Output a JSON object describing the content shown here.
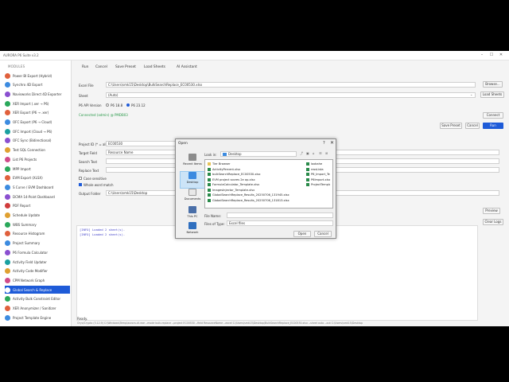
{
  "app": {
    "title": "AURORA P6 Suite v3.2",
    "window_controls": [
      "–",
      "☐",
      "✕"
    ]
  },
  "sidebar": {
    "header": "MODULES",
    "items": [
      {
        "label": "Power BI Export (Hybrid)",
        "color": "#e0603c"
      },
      {
        "label": "Synchro 4D Export",
        "color": "#3c8be0"
      },
      {
        "label": "Navisworks Direct 4D Exporter",
        "color": "#8a4fd0"
      },
      {
        "label": "XER Import (.xer → P6)",
        "color": "#2aa85a"
      },
      {
        "label": "XER Export (P6 → .xer)",
        "color": "#e0603c"
      },
      {
        "label": "OFC Export (P6 → Cloud)",
        "color": "#3c8be0"
      },
      {
        "label": "OFC Import (Cloud → P6)",
        "color": "#1aa0a0"
      },
      {
        "label": "OFC Sync (Bidirectional)",
        "color": "#8a4fd0"
      },
      {
        "label": "Test SQL Connection",
        "color": "#e0a030"
      },
      {
        "label": "List P6 Projects",
        "color": "#d04a8a"
      },
      {
        "label": "MPP Import",
        "color": "#2aa85a"
      },
      {
        "label": "EVM Export (XLSX)",
        "color": "#e0603c"
      },
      {
        "label": "S Curve / EVM Dashboard",
        "color": "#3c8be0"
      },
      {
        "label": "DCMA 14-Point Dashboard",
        "color": "#8a4fd0"
      },
      {
        "label": "PDF Report",
        "color": "#d03c3c"
      },
      {
        "label": "Schedule Update",
        "color": "#e0a030"
      },
      {
        "label": "WBS Summary",
        "color": "#2aa85a"
      },
      {
        "label": "Resource Histogram",
        "color": "#e0603c"
      },
      {
        "label": "Project Summary",
        "color": "#3c8be0"
      },
      {
        "label": "P6 Formula Calculator",
        "color": "#8a4fd0"
      },
      {
        "label": "Activity Field Updater",
        "color": "#1aa0a0"
      },
      {
        "label": "Activity Code Modifier",
        "color": "#e0a030"
      },
      {
        "label": "CPM Network Graph",
        "color": "#d04a8a"
      },
      {
        "label": "Global Search & Replace",
        "color": "#1e5bd8",
        "active": true
      },
      {
        "label": "Activity Bulk Constraint Editor",
        "color": "#2aa85a"
      },
      {
        "label": "XER Anonymizer / Sanitizer",
        "color": "#e0603c"
      },
      {
        "label": "Project Template Engine",
        "color": "#3c8be0"
      }
    ]
  },
  "toolbar": {
    "run": "Run",
    "cancel": "Cancel",
    "save_preset": "Save Preset",
    "load_sheets": "Load Sheets",
    "ai_assistant": "AI Assistant"
  },
  "form": {
    "excel_file_label": "Excel File",
    "excel_file_value": "C:\\Users\\smk15\\Desktop\\BulkSearchReplace_EC00530.xlsx",
    "browse": "Browse...",
    "sheet_label": "Sheet",
    "sheet_value": "(Auto)",
    "load_sheets_btn": "Load Sheets",
    "p6_api_label": "P6 API Version",
    "p6_v1": "P6 18.8",
    "p6_v2": "P6 23.12",
    "connected": "Connected (admin) @ PMDB03",
    "connect_btn": "Connect",
    "save_preset_btn": "Save Preset",
    "cancel_btn": "Cancel",
    "run_btn": "Run",
    "project_id_label": "Project ID (* = all)",
    "project_id_value": "EC00530",
    "target_field_label": "Target Field",
    "target_field_value": "Resource Name",
    "search_text_label": "Search Text",
    "replace_text_label": "Replace Text",
    "case_sensitive": "Case sensitive",
    "whole_word": "Whole word match",
    "output_folder_label": "Output Folder",
    "output_folder_value": "C:\\Users\\smk15\\Desktop",
    "preview_btn": "Preview",
    "clear_logs_btn": "Clear Logs"
  },
  "log": {
    "lines": [
      "[INFO] Loaded 2 sheet(s).",
      "[INFO] Loaded 2 sheet(s)."
    ]
  },
  "status": {
    "text": "Ready.",
    "cmd": "Oryx/Crypto (3.12.9) C:\\Windows\\Temp\\aurora-cli.exe --mode bulk-replace --project EC00530 --field ResourceName --excel C:\\Users\\smk15\\Desktop\\BulkSearchReplace_EC00530.xlsx --sheet auto --out C:\\Users\\smk15\\Desktop"
  },
  "dialog": {
    "title": "Open",
    "help": "?",
    "close": "✕",
    "look_in_label": "Look in:",
    "look_in_value": "Desktop",
    "places": [
      "Recent Items",
      "Desktop",
      "Documents",
      "This PC",
      "Network"
    ],
    "files_col1": [
      {
        "name": "Tier Browser",
        "type": "folder"
      },
      {
        "name": "ActivityPercent.xlsx",
        "type": "xlsx"
      },
      {
        "name": "bulkSearchReplace_EC00530.xlsx",
        "type": "xlsx"
      },
      {
        "name": "EVM project scores 2e ap.xlsx",
        "type": "xlsx"
      },
      {
        "name": "FormulaCalculator_Template.xlsx",
        "type": "xlsx"
      },
      {
        "name": "ImagesInjector_Template.xlsx",
        "type": "xlsx"
      },
      {
        "name": "GlobalSearchReplace_Results_20250706_131945.xlsx",
        "type": "xlsx"
      },
      {
        "name": "GlobalSearchReplace_Results_20250706_131813.xlsx",
        "type": "xlsx"
      }
    ],
    "files_col2": [
      {
        "name": "lookahe",
        "type": "xlsx"
      },
      {
        "name": "nwsLista",
        "type": "xlsx"
      },
      {
        "name": "P6_Import_Tem",
        "type": "xlsx"
      },
      {
        "name": "P6Import.xlsx",
        "type": "xlsx"
      },
      {
        "name": "ProjectTemplat",
        "type": "xlsx"
      }
    ],
    "file_name_label": "File Name:",
    "file_name_value": "",
    "files_of_type_label": "Files of Type:",
    "files_of_type_value": "Excel files",
    "open_btn": "Open",
    "cancel_btn": "Cancel"
  }
}
